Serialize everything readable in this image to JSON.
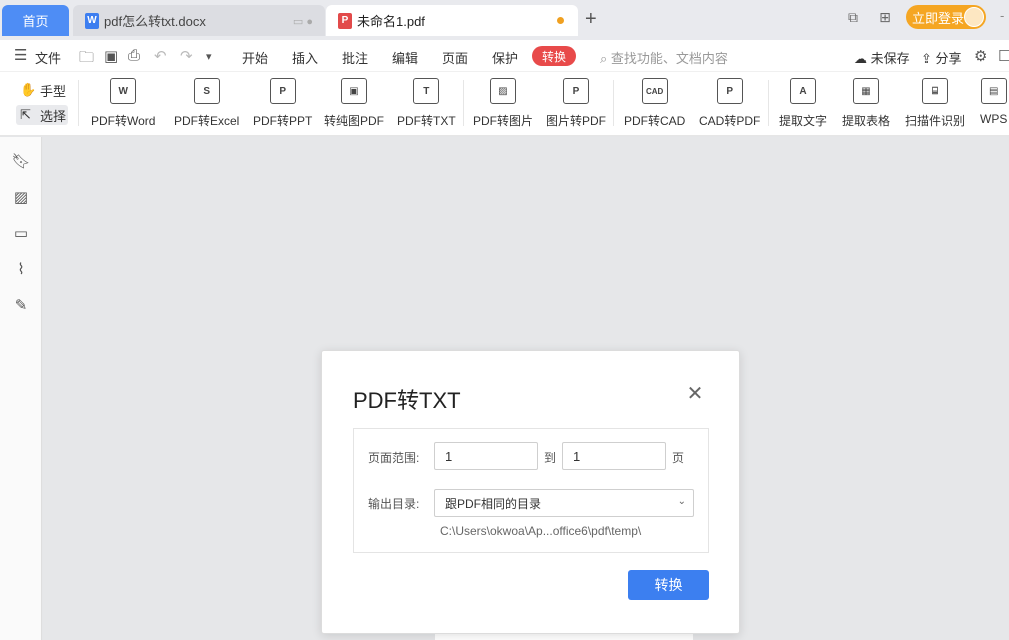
{
  "tabs": {
    "home": "首页",
    "docx_title": "pdf怎么转txt.docx",
    "pdf_title": "未命名1.pdf",
    "new_tab": "+",
    "login": "立即登录"
  },
  "menu": {
    "file": "文件",
    "items": [
      "开始",
      "插入",
      "批注",
      "编辑",
      "页面",
      "保护"
    ],
    "active": "转换",
    "search_placeholder": "查找功能、文档内容",
    "unsaved": "未保存",
    "share": "分享"
  },
  "ribbon": {
    "hand": "手型",
    "select": "选择",
    "buttons": [
      {
        "label": "PDF转Word",
        "icon": "W"
      },
      {
        "label": "PDF转Excel",
        "icon": "S"
      },
      {
        "label": "PDF转PPT",
        "icon": "P"
      },
      {
        "label": "转纯图PDF",
        "icon": "▣"
      },
      {
        "label": "PDF转TXT",
        "icon": "T"
      },
      {
        "label": "PDF转图片",
        "icon": "▨"
      },
      {
        "label": "图片转PDF",
        "icon": "P"
      },
      {
        "label": "PDF转CAD",
        "icon": "CAD"
      },
      {
        "label": "CAD转PDF",
        "icon": "P"
      },
      {
        "label": "提取文字",
        "icon": "A"
      },
      {
        "label": "提取表格",
        "icon": "▦"
      },
      {
        "label": "扫描件识别",
        "icon": "⌸"
      },
      {
        "label": "WPS",
        "icon": "▤"
      }
    ]
  },
  "dialog": {
    "title": "PDF转TXT",
    "page_range_label": "页面范围:",
    "from_value": "1",
    "to_label": "到",
    "to_value": "1",
    "page_suffix": "页",
    "output_label": "输出目录:",
    "output_selected": "跟PDF相同的目录",
    "output_path": "C:\\Users\\okwoa\\Ap...office6\\pdf\\temp\\",
    "convert_button": "转换"
  }
}
